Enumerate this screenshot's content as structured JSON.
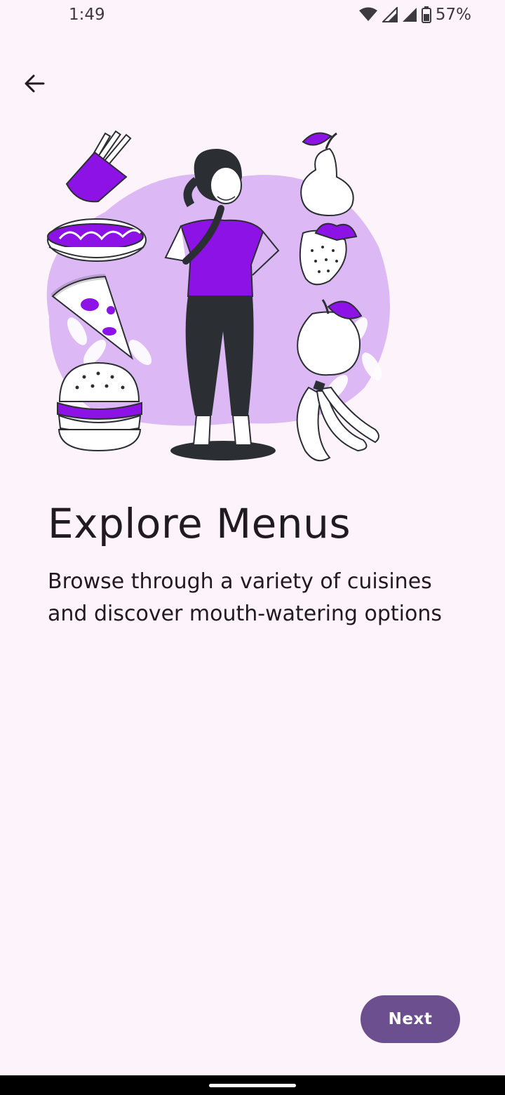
{
  "status_bar": {
    "time": "1:49",
    "battery": "57%",
    "icons": [
      "wifi-icon",
      "signal-icon",
      "battery-icon"
    ]
  },
  "header": {
    "back_icon": "arrow-left-icon"
  },
  "illustration": {
    "icon": "woman-thinking-food-illustration"
  },
  "content": {
    "title": "Explore Menus",
    "subtitle": "Browse through a variety of cuisines and discover mouth-watering options"
  },
  "footer": {
    "next_label": "Next"
  },
  "colors": {
    "background": "#fdf4fb",
    "accent_purple": "#8d12e6",
    "blob": "#dcb8f5",
    "button": "#6b4f8e"
  }
}
